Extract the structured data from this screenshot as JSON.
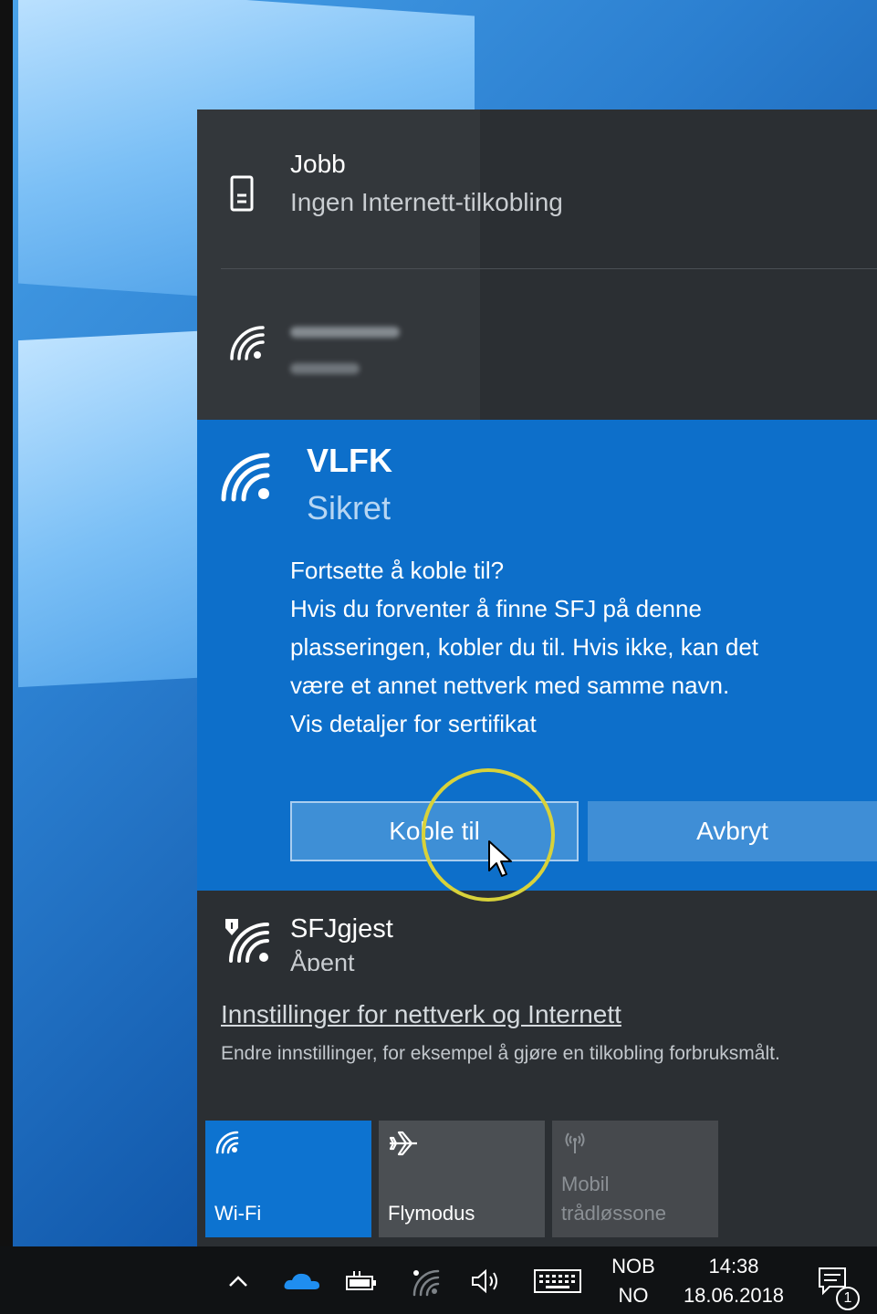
{
  "networks": {
    "jobb": {
      "name": "Jobb",
      "status": "Ingen Internett-tilkobling"
    },
    "hidden": {
      "name": "",
      "status": ""
    },
    "vlfk": {
      "name": "VLFK",
      "status": "Sikret",
      "prompt_lines": [
        "Fortsette å koble til?",
        "Hvis du forventer å finne SFJ på denne",
        "plasseringen, kobler du til. Hvis ikke, kan det",
        "være et annet nettverk med samme navn.",
        "Vis detaljer for sertifikat"
      ],
      "connect_label": "Koble til",
      "cancel_label": "Avbryt"
    },
    "sfjgjest": {
      "name": "SFJgjest",
      "status": "Åpent"
    }
  },
  "settings": {
    "link": "Innstillinger for nettverk og Internett",
    "description": "Endre innstillinger, for eksempel å gjøre en tilkobling forbruksmålt."
  },
  "quick_actions": {
    "wifi": "Wi-Fi",
    "airplane": "Flymodus",
    "mobile_line1": "Mobil",
    "mobile_line2": "trådløssone"
  },
  "taskbar": {
    "lang_top": "NOB",
    "lang_bottom": "NO",
    "time": "14:38",
    "date": "18.06.2018",
    "notification_count": "1"
  },
  "colors": {
    "accent": "#0d6fca",
    "flyout_bg": "#2b2f33",
    "taskbar_bg": "#101214",
    "highlight_ring": "#d8d23a"
  }
}
